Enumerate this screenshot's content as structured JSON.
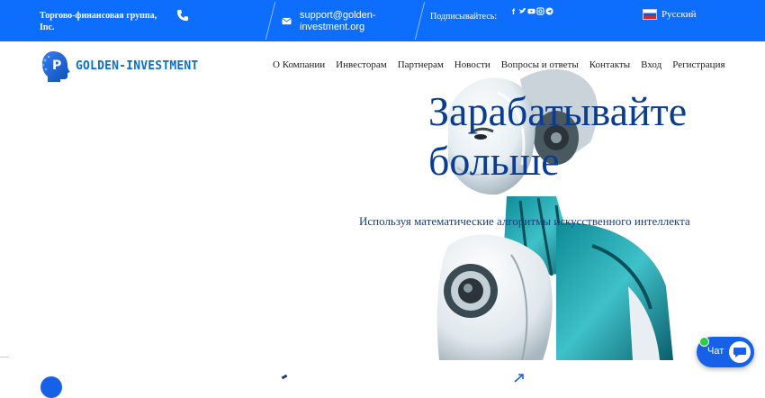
{
  "topbar": {
    "company": "Торгово-финансовая группа, Inc.",
    "email": "support@golden-investment.org",
    "follow_label": "Подписывайтесь:",
    "social_icons": [
      "facebook-icon",
      "twitter-icon",
      "youtube-icon",
      "instagram-icon",
      "telegram-icon"
    ],
    "language": "Русский"
  },
  "logo": {
    "text": "GOLDEN-INVESTMENT"
  },
  "nav": {
    "items": [
      "О Компании",
      "Инвесторам",
      "Партнерам",
      "Новости",
      "Вопросы и ответы",
      "Контакты",
      "Вход",
      "Регистрация"
    ]
  },
  "hero": {
    "title_line1": "Зарабатывайте",
    "title_line2": "больше",
    "subtitle": "Используя математические алгоритмы искусственного интеллекта"
  },
  "chat": {
    "label": "Чат"
  },
  "colors": {
    "primary": "#0d6efd",
    "title": "#0a3d91",
    "online": "#2ecc40"
  }
}
